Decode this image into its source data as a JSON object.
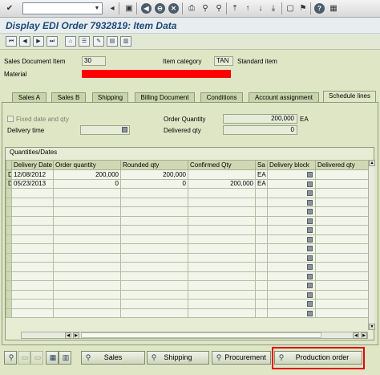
{
  "window": {
    "title": "Display EDI Order 7932819: Item Data"
  },
  "header": {
    "sales_doc_item_label": "Sales Document Item",
    "sales_doc_item_value": "30",
    "item_category_label": "Item category",
    "item_category_value": "TAN",
    "item_category_text": "Standard item",
    "material_label": "Material"
  },
  "tabs": [
    {
      "label": "Sales A",
      "active": false
    },
    {
      "label": "Sales B",
      "active": false
    },
    {
      "label": "Shipping",
      "active": false
    },
    {
      "label": "Billing Document",
      "active": false
    },
    {
      "label": "Conditions",
      "active": false
    },
    {
      "label": "Account assignment",
      "active": false
    },
    {
      "label": "Schedule lines",
      "active": true
    }
  ],
  "schedule": {
    "fixed_date_label": "Fixed date and qty",
    "delivery_time_label": "Delivery time",
    "order_qty_label": "Order Quantity",
    "order_qty_value": "200,000",
    "order_qty_unit": "EA",
    "delivered_qty_label": "Delivered qty",
    "delivered_qty_value": "0"
  },
  "table": {
    "title": "Quantities/Dates",
    "columns": [
      "",
      "Delivery Date",
      "Order quantity",
      "Rounded qty",
      "Confirmed Qty",
      "Sa",
      "Delivery block",
      "Delivered qty"
    ],
    "rows": [
      {
        "sel": "D",
        "date": "12/08/2012",
        "order_qty": "200,000",
        "rounded": "200,000",
        "confirmed": "",
        "unit": "EA"
      },
      {
        "sel": "D",
        "date": "05/23/2013",
        "order_qty": "0",
        "rounded": "0",
        "confirmed": "200,000",
        "unit": "EA"
      }
    ]
  },
  "buttons": {
    "sales": "Sales",
    "shipping": "Shipping",
    "procurement": "Procurement",
    "production_order": "Production order"
  },
  "colors": {
    "title": "#1d4a77",
    "highlight": "#e30613",
    "material_redaction": "#ff0000"
  }
}
